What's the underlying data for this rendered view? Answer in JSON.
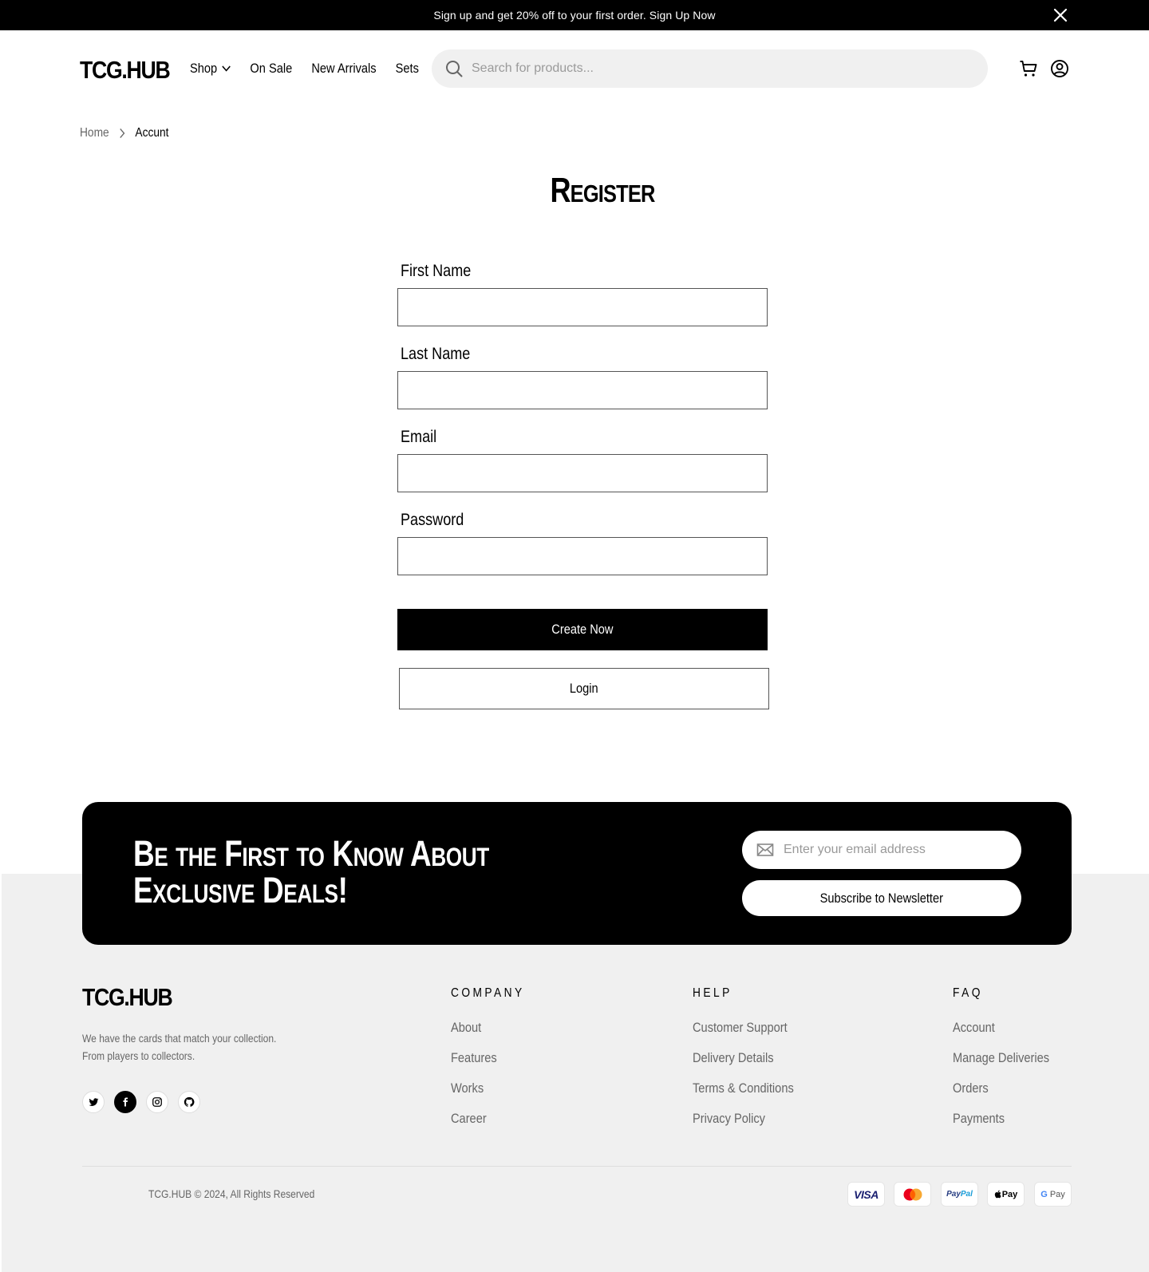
{
  "topbar": {
    "text": "Sign up and get 20% off to your first order. Sign Up Now"
  },
  "header": {
    "logo": "TCG.HUB",
    "nav": [
      "Shop",
      "On Sale",
      "New Arrivals",
      "Sets"
    ],
    "search_placeholder": "Search for products..."
  },
  "breadcrumb": {
    "home": "Home",
    "current": "Accunt"
  },
  "form": {
    "title": "Register",
    "fields": [
      {
        "label": "First Name",
        "value": ""
      },
      {
        "label": "Last Name",
        "value": ""
      },
      {
        "label": "Email",
        "value": ""
      },
      {
        "label": "Password",
        "value": ""
      }
    ],
    "create_label": "Create Now",
    "login_label": "Login"
  },
  "newsletter": {
    "title": "Be the First to Know About Exclusive Deals!",
    "email_placeholder": "Enter your email address",
    "button_label": "Subscribe to Newsletter"
  },
  "footer": {
    "logo": "TCG.HUB",
    "tagline_line1": "We have the cards that match your collection.",
    "tagline_line2": "From players to collectors.",
    "social_icons": [
      "twitter-icon",
      "facebook-icon",
      "instagram-icon",
      "github-icon"
    ],
    "columns": [
      {
        "title": "COMPANY",
        "links": [
          "About",
          "Features",
          "Works",
          "Career"
        ]
      },
      {
        "title": "HELP",
        "links": [
          "Customer Support",
          "Delivery Details",
          "Terms & Conditions",
          "Privacy Policy"
        ]
      },
      {
        "title": "FAQ",
        "links": [
          "Account",
          "Manage Deliveries",
          "Orders",
          "Payments"
        ]
      }
    ],
    "copyright": "TCG.HUB © 2024, All Rights Reserved",
    "payments": [
      "VISA",
      "Mastercard",
      "PayPal",
      "Apple Pay",
      "G Pay"
    ]
  },
  "colors": {
    "primary": "#000000",
    "surface": "#f0f0f0",
    "muted_text": "#666666",
    "visa": "#1a1f71"
  }
}
